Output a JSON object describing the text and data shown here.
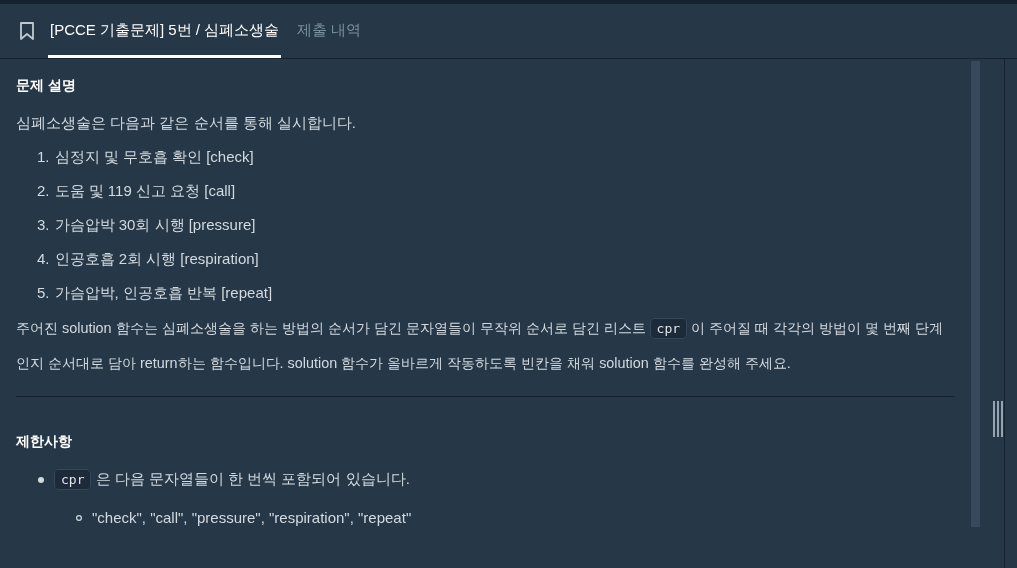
{
  "tabs": [
    {
      "label": "[PCCE 기출문제] 5번 / 심폐소생술",
      "selected": true
    },
    {
      "label": "제출 내역",
      "selected": false
    }
  ],
  "description": {
    "heading": "문제 설명",
    "intro": "심폐소생술은 다음과 같은 순서를 통해 실시합니다.",
    "steps": [
      {
        "marker": "1.",
        "text": "심정지 및 무호흡 확인 [check]"
      },
      {
        "marker": "2.",
        "text": "도움 및 119 신고 요청 [call]"
      },
      {
        "marker": "3.",
        "text": "가슴압박 30회 시행 [pressure]"
      },
      {
        "marker": "4.",
        "text": "인공호흡 2회 시행 [respiration]"
      },
      {
        "marker": "5.",
        "text": "가슴압박, 인공호흡 반복 [repeat]"
      }
    ],
    "paragraph": [
      {
        "kind": "text",
        "text": "주어진 solution 함수는 심폐소생술을 하는 방법의 순서가 담긴 문자열들이 무작위 순서로 담긴 리스트 "
      },
      {
        "kind": "code",
        "text": "cpr"
      },
      {
        "kind": "text",
        "text": " 이 주어질 때 각각의 방법이 몇 번째 단계인지 순서대로 담아 return하는 함수입니다. solution 함수가 올바르게 작동하도록 빈칸을 채워 solution 함수를 완성해 주세요."
      }
    ]
  },
  "constraints": {
    "heading": "제한사항",
    "items": [
      {
        "parts": [
          {
            "kind": "code",
            "text": "cpr"
          },
          {
            "kind": "text",
            "text": " 은 다음 문자열들이 한 번씩 포함되어 있습니다."
          }
        ],
        "children": [
          {
            "parts": [
              {
                "kind": "text",
                "text": "\"check\", \"call\", \"pressure\", \"respiration\", \"repeat\""
              }
            ]
          }
        ]
      }
    ]
  }
}
